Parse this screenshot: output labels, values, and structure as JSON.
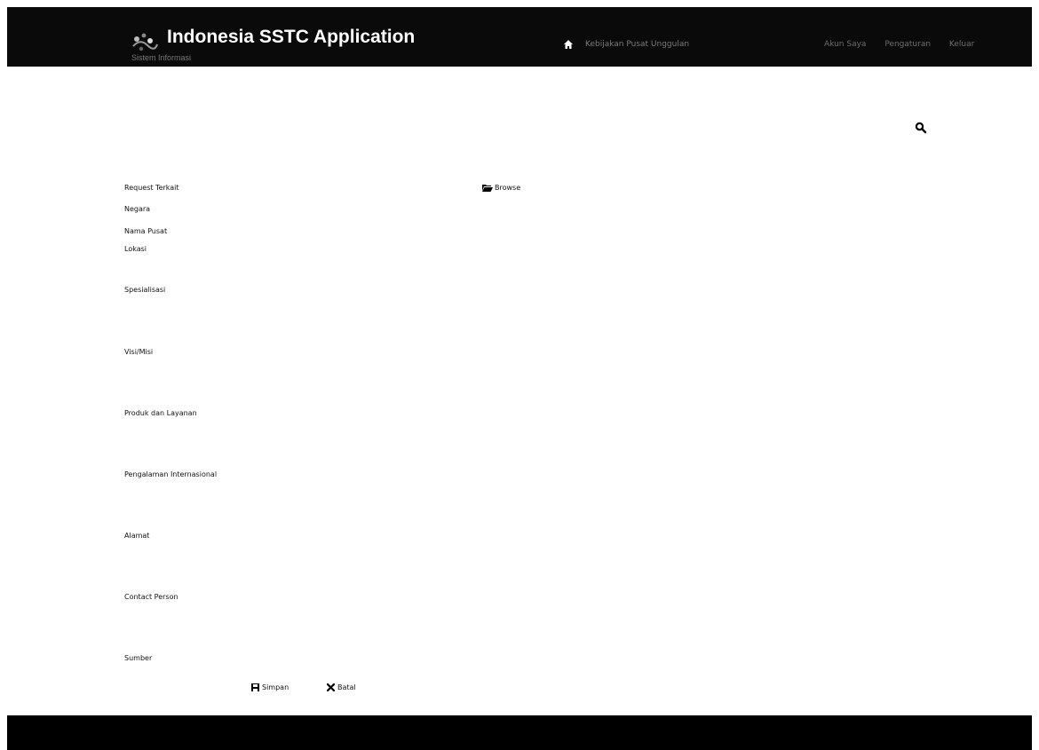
{
  "header": {
    "app_title": "Indonesia SSTC Application",
    "app_subtitle": "Sistem Informasi",
    "home_link": "Kebijakan Pusat Unggulan",
    "user_links": [
      "Akun Saya",
      "Pengaturan",
      "Keluar"
    ]
  },
  "toolbar": {
    "search_icon": "search-icon"
  },
  "form": {
    "browse_label": "Browse",
    "fields": [
      "Request Terkait",
      "Negara",
      "Nama Pusat",
      "Lokasi",
      "Spesialisasi",
      "Visi/Misi",
      "Produk dan Layanan",
      "Pengalaman Internasional",
      "Alamat",
      "Contact Person",
      "Sumber"
    ],
    "save_label": "Simpan",
    "cancel_label": "Batal"
  },
  "colors": {
    "bar": "#0a0a0a",
    "background": "#ffffff"
  }
}
